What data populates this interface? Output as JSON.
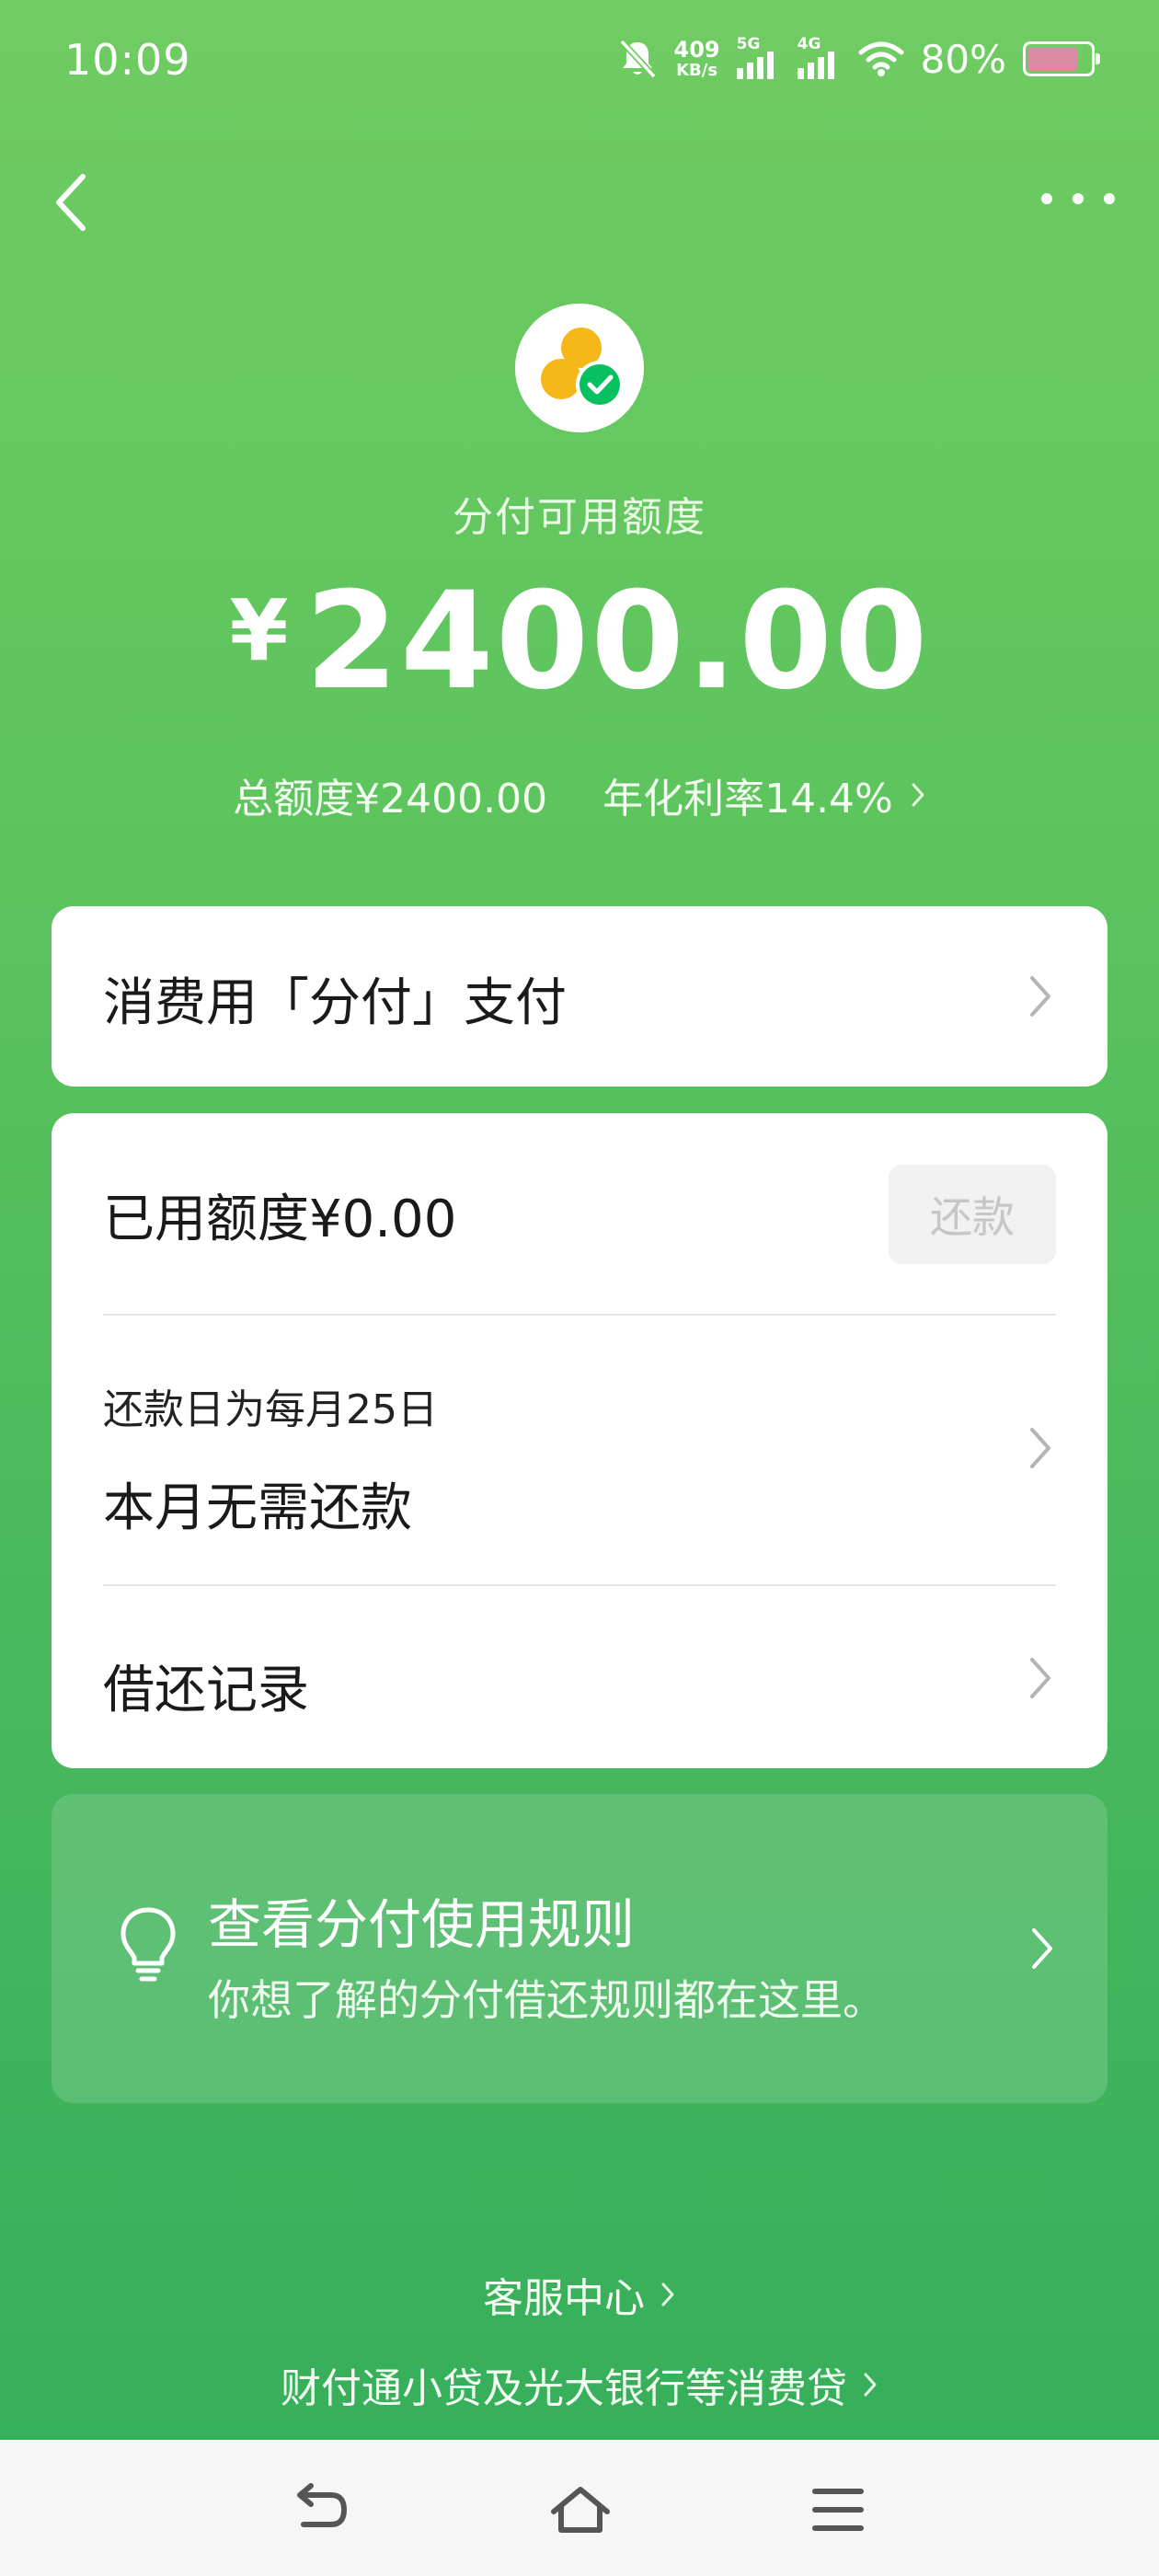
{
  "status_bar": {
    "time": "10:09",
    "net_speed_value": "409",
    "net_speed_unit": "KB/s",
    "sim1_tag": "5G",
    "sim2_tag": "4G",
    "battery_percent": "80%"
  },
  "header": {
    "limit_label": "分付可用额度",
    "currency_symbol": "¥",
    "available_amount": "2400.00",
    "total_limit": "总额度¥2400.00",
    "annual_rate": "年化利率14.4%"
  },
  "pay_card": {
    "label": "消费用「分付」支付"
  },
  "usage_card": {
    "used_label": "已用额度¥0.00",
    "repay_button": "还款",
    "due_day_label": "还款日为每月25日",
    "due_status": "本月无需还款",
    "records_label": "借还记录"
  },
  "rules_card": {
    "title": "查看分付使用规则",
    "subtitle": "你想了解的分付借还规则都在这里。"
  },
  "footer": {
    "service_center": "客服中心",
    "lenders": "财付通小贷及光大银行等消费贷"
  },
  "colors": {
    "bg_top": "#6fcc62",
    "bg_bottom": "#33ad5b",
    "logo_yellow": "#f6b718",
    "logo_green": "#07c160"
  }
}
